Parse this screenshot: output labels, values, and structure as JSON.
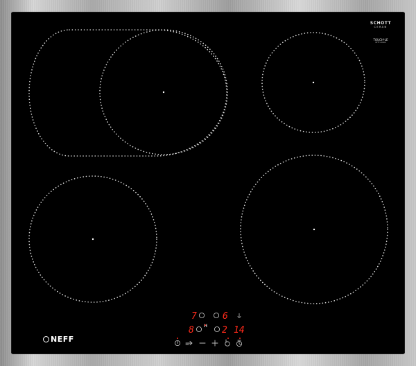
{
  "appliance": {
    "type": "induction cooktop",
    "glass_color": "#000000",
    "frame_color": "#b8b8b8",
    "zone_outline_color": "#d8d8d8",
    "display_color": "#ff2a1a",
    "symbol_color": "#bfbfbf"
  },
  "glass_logo": {
    "brand": "SCHOTT",
    "sub": "CERAN",
    "code": "TOUCH*LE",
    "fine": "NFFF-20000"
  },
  "brand_logo": {
    "text": "NEFF"
  },
  "cooking_zones": [
    "rear-left-flex",
    "rear-right",
    "front-left",
    "front-right"
  ],
  "control_panel": {
    "rear_left_display": "7",
    "rear_right_display": "6",
    "front_left_display": "8",
    "front_right_display": "2",
    "timer_display": "14",
    "flex_indicator": "H",
    "buttons": [
      "power-icon",
      "flex-icon",
      "minus-icon",
      "plus-icon",
      "lock-icon",
      "timer-icon"
    ]
  }
}
